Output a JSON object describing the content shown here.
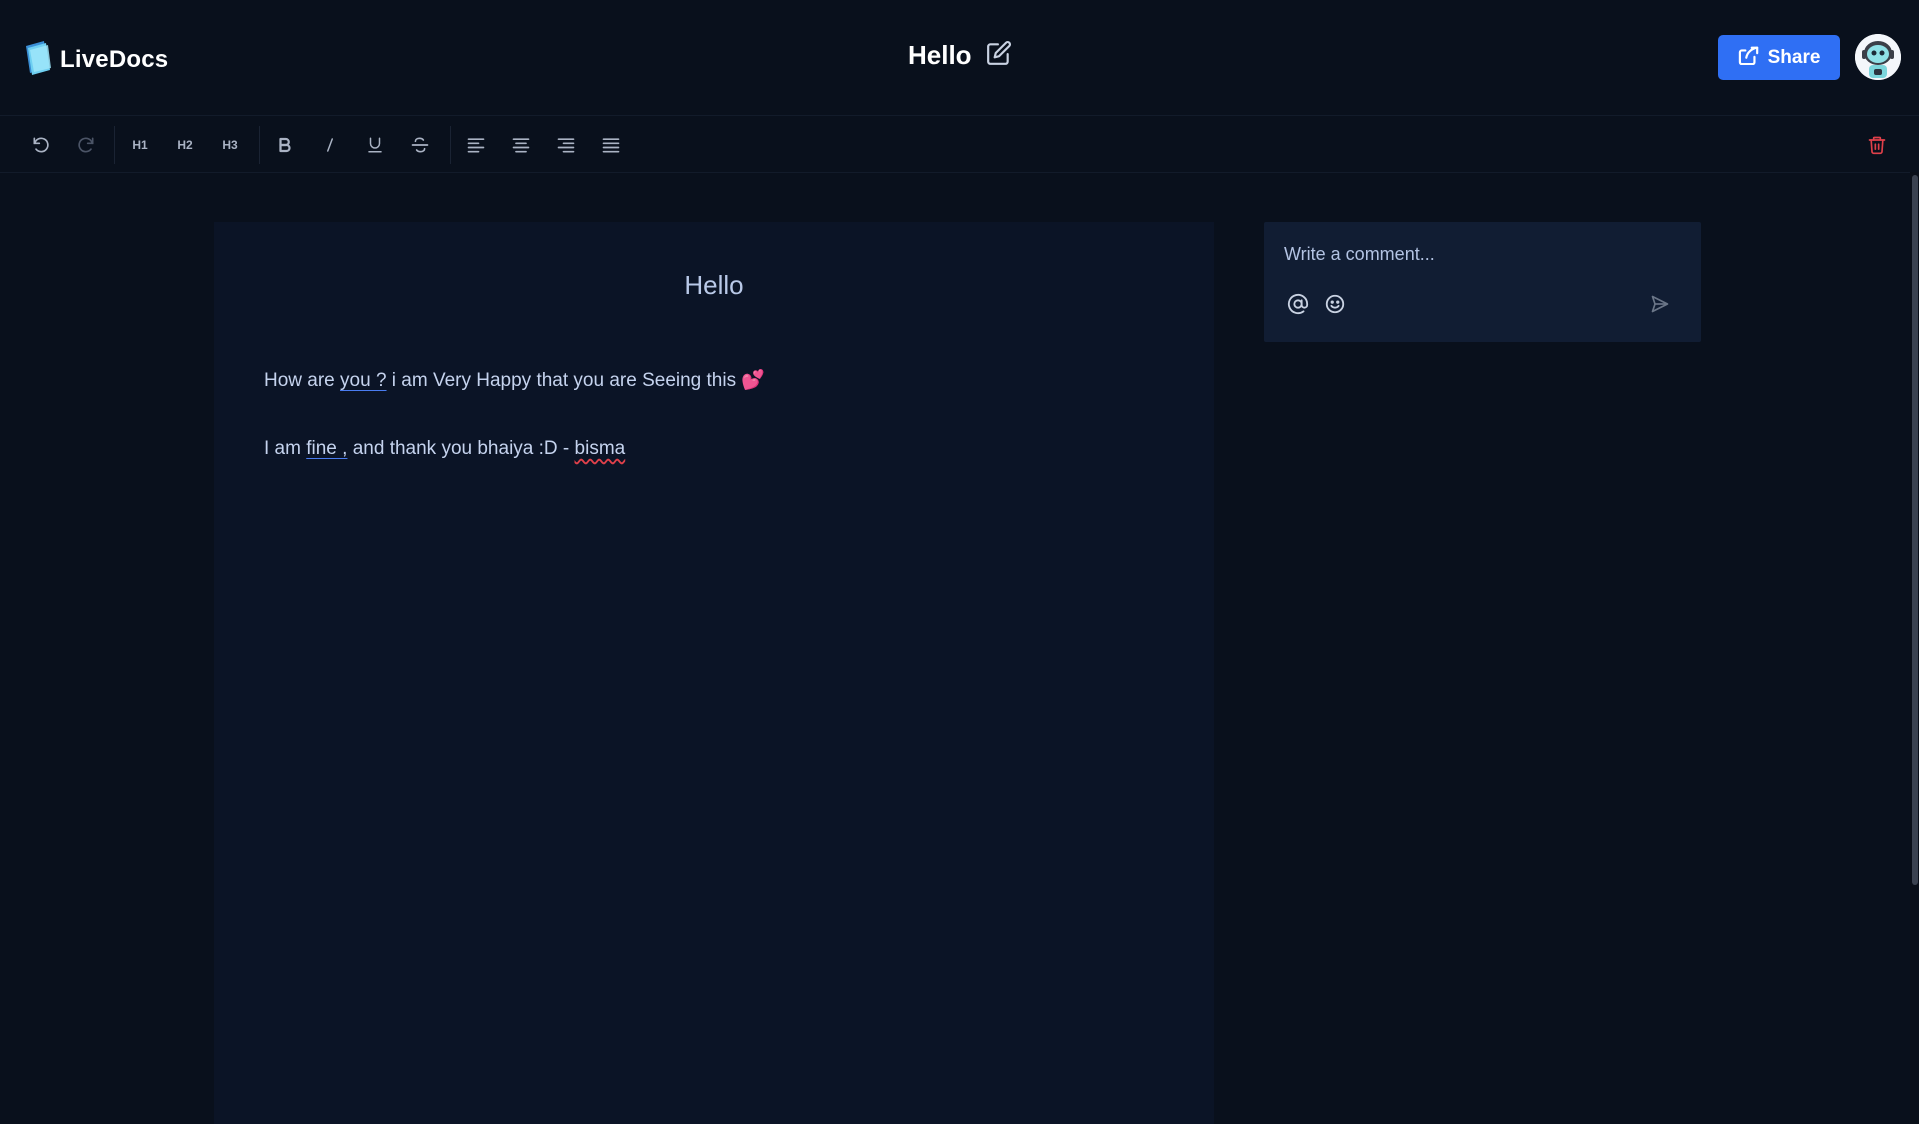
{
  "app": {
    "name": "LiveDocs"
  },
  "document": {
    "title": "Hello"
  },
  "header": {
    "share_label": "Share"
  },
  "toolbar": {
    "undo_icon": "undo-icon",
    "redo_icon": "redo-icon",
    "heading_labels": [
      "H1",
      "H2",
      "H3"
    ],
    "format_icons": [
      "bold-icon",
      "italic-icon",
      "underline-icon",
      "strikethrough-icon"
    ],
    "align_icons": [
      "align-left-icon",
      "align-center-icon",
      "align-right-icon",
      "align-justify-icon"
    ],
    "delete_icon": "trash-icon"
  },
  "editor": {
    "heading": "Hello",
    "para1": {
      "before": "How are ",
      "underlined": "you ?",
      "after": "  i am Very Happy that you are Seeing this ",
      "emoji": "💕"
    },
    "para2": {
      "before": "I am ",
      "underlined": "fine ,",
      "middle": " and thank you bhaiya :D - ",
      "misspelled": "bisma"
    }
  },
  "comments": {
    "placeholder": "Write a comment...",
    "icons": [
      "at-mention-icon",
      "emoji-icon",
      "send-icon"
    ]
  },
  "colors": {
    "accent": "#2f6ff4",
    "background": "#09101c",
    "editor_bg": "#0b1426",
    "comment_bg": "#111d33",
    "danger": "#e0404a"
  }
}
